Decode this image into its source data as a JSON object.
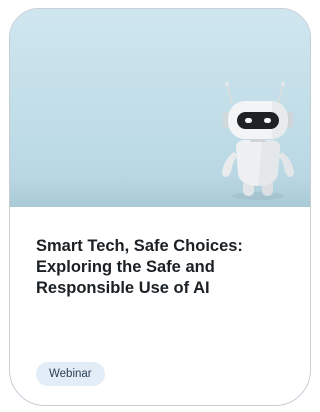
{
  "card": {
    "title": "Smart Tech, Safe Choices: Exploring the Safe and Responsible Use of AI",
    "badge": "Webinar",
    "image": {
      "icon": "robot-illustration",
      "background_color": "#c3dde8",
      "eye_color": "#1e2226"
    }
  }
}
